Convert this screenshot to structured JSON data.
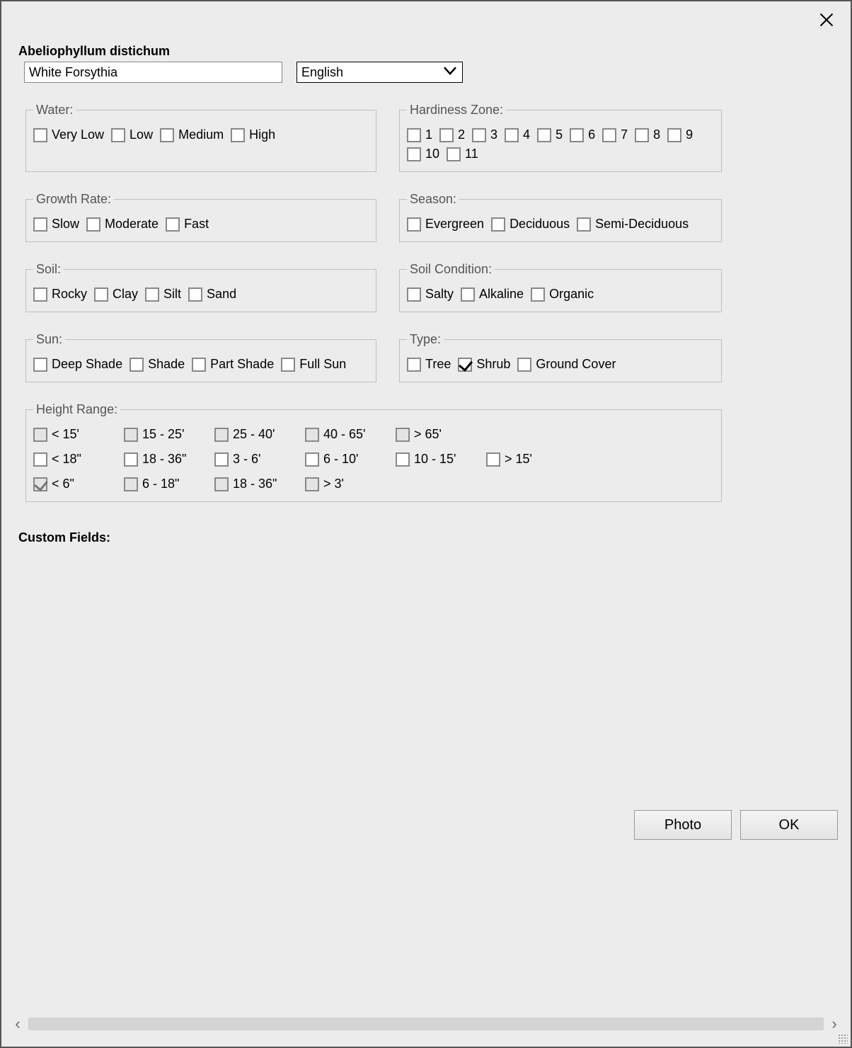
{
  "title": "Abeliophyllum distichum",
  "common_name_value": "White Forsythia",
  "language_selected": "English",
  "groups": {
    "water": {
      "legend": "Water:",
      "options": [
        "Very Low",
        "Low",
        "Medium",
        "High"
      ],
      "checked": [],
      "disabled": []
    },
    "hardiness": {
      "legend": "Hardiness Zone:",
      "options": [
        "1",
        "2",
        "3",
        "4",
        "5",
        "6",
        "7",
        "8",
        "9",
        "10",
        "11"
      ],
      "checked": [],
      "disabled": []
    },
    "growth": {
      "legend": "Growth Rate:",
      "options": [
        "Slow",
        "Moderate",
        "Fast"
      ],
      "checked": [],
      "disabled": []
    },
    "season": {
      "legend": "Season:",
      "options": [
        "Evergreen",
        "Deciduous",
        "Semi-Deciduous"
      ],
      "checked": [],
      "disabled": []
    },
    "soil": {
      "legend": "Soil:",
      "options": [
        "Rocky",
        "Clay",
        "Silt",
        "Sand"
      ],
      "checked": [],
      "disabled": []
    },
    "soilcond": {
      "legend": "Soil Condition:",
      "options": [
        "Salty",
        "Alkaline",
        "Organic"
      ],
      "checked": [],
      "disabled": []
    },
    "sun": {
      "legend": "Sun:",
      "options": [
        "Deep Shade",
        "Shade",
        "Part Shade",
        "Full Sun"
      ],
      "checked": [],
      "disabled": []
    },
    "type": {
      "legend": "Type:",
      "options": [
        "Tree",
        "Shrub",
        "Ground Cover"
      ],
      "checked": [
        "Shrub"
      ],
      "disabled": []
    },
    "height": {
      "legend": "Height Range:",
      "rows": [
        {
          "options": [
            "< 15'",
            "15 - 25'",
            "25 - 40'",
            "40 - 65'",
            "> 65'"
          ],
          "disabled_all": true,
          "checked": []
        },
        {
          "options": [
            "< 18\"",
            "18 - 36\"",
            "3 - 6'",
            "6 - 10'",
            "10 - 15'",
            "> 15'"
          ],
          "disabled_all": false,
          "checked": []
        },
        {
          "options": [
            "< 6\"",
            "6 - 18\"",
            "18 - 36\"",
            "> 3'"
          ],
          "disabled_all": true,
          "checked": [
            "< 6\""
          ]
        }
      ]
    }
  },
  "custom_fields_label": "Custom Fields:",
  "buttons": {
    "photo": "Photo",
    "ok": "OK"
  }
}
